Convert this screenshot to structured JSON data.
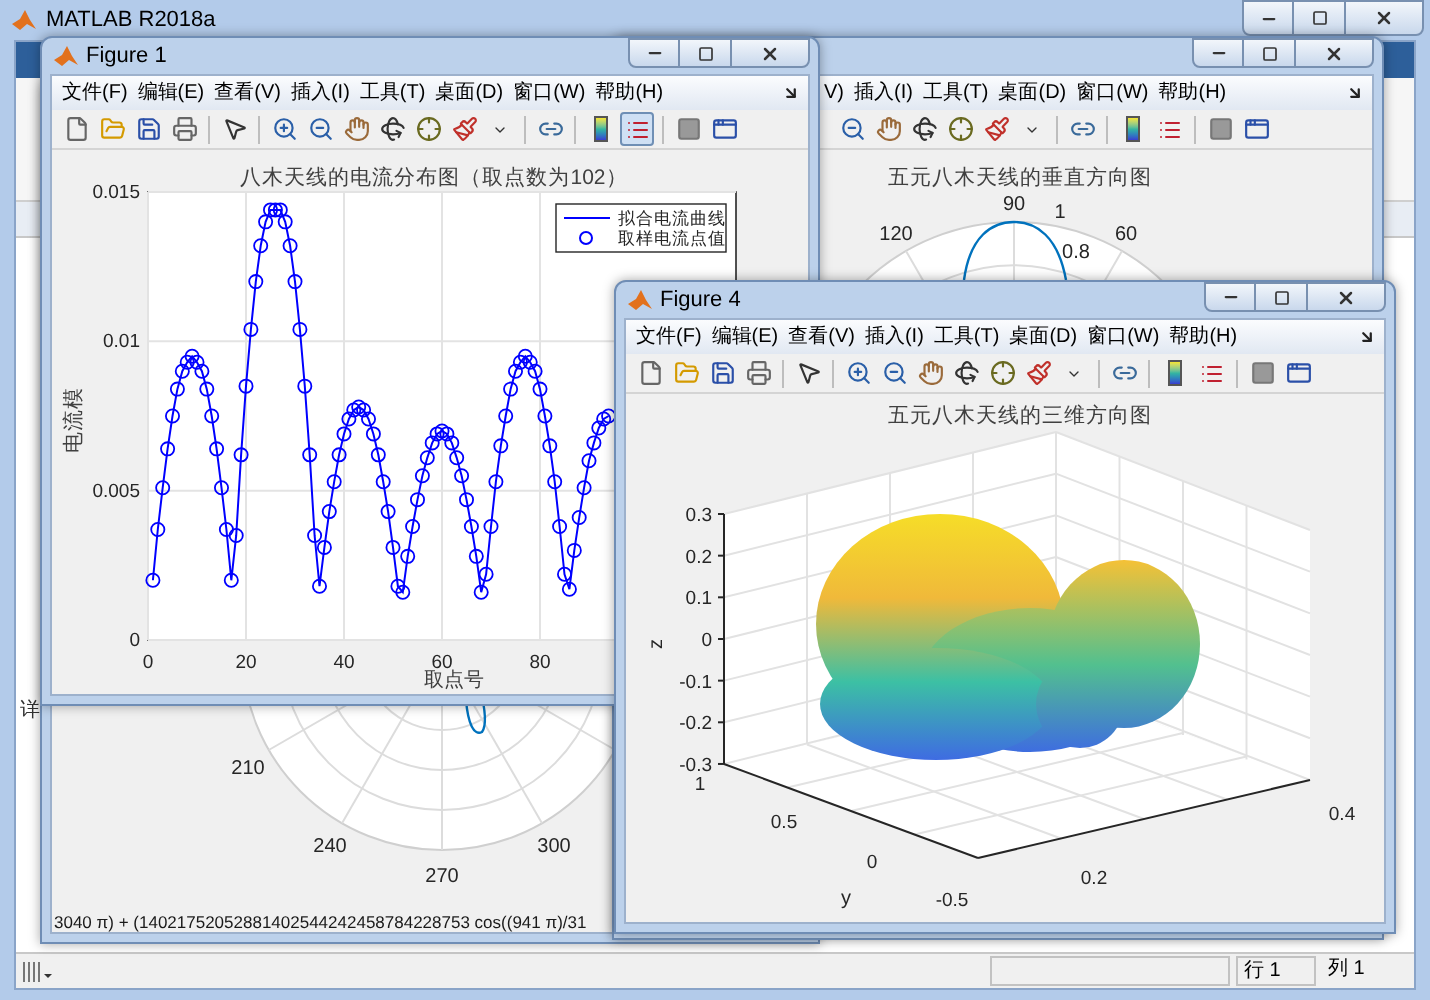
{
  "main_window": {
    "title": "MATLAB R2018a",
    "side_label": "详",
    "status_bar": {
      "row": "行 1",
      "column": "列 1"
    }
  },
  "figure_3": {
    "plot": {
      "angle_labels": [
        "210",
        "240",
        "270",
        "300"
      ],
      "caption": "3040 π) + (14021752052881402544242458784228753 cos((941 π)/31"
    }
  },
  "figure_2": {
    "menu": [
      "V)",
      "插入(I)",
      "工具(T)",
      "桌面(D)",
      "窗口(W)",
      "帮助(H)"
    ],
    "plot": {
      "title": "五元八木天线的垂直方向图",
      "angle_labels": [
        "90",
        "120",
        "60"
      ],
      "radius_labels": [
        "1",
        "0.8"
      ]
    }
  },
  "figure_1": {
    "title": "Figure 1",
    "marker_legend": "取样电流点值",
    "menu": [
      "文件(F)",
      "编辑(E)",
      "查看(V)",
      "插入(I)",
      "工具(T)",
      "桌面(D)",
      "窗口(W)",
      "帮助(H)"
    ],
    "toolbar": {
      "legend_on": true
    },
    "chart_data": {
      "type": "line",
      "grid": true,
      "title": "八木天线的电流分布图（取点数为102）",
      "xlabel": "取点号",
      "ylabel": "电流模",
      "xlim": [
        0,
        120
      ],
      "ylim": [
        0,
        0.015
      ],
      "xticks": [
        0,
        20,
        40,
        60,
        80
      ],
      "yticks": [
        0,
        0.005,
        0.01,
        0.015
      ],
      "x": [
        1,
        2,
        3,
        4,
        5,
        6,
        7,
        8,
        9,
        10,
        11,
        12,
        13,
        14,
        15,
        16,
        17,
        18,
        19,
        20,
        21,
        22,
        23,
        24,
        25,
        26,
        27,
        28,
        29,
        30,
        31,
        32,
        33,
        34,
        35,
        36,
        37,
        38,
        39,
        40,
        41,
        42,
        43,
        44,
        45,
        46,
        47,
        48,
        49,
        50,
        51,
        52,
        53,
        54,
        55,
        56,
        57,
        58,
        59,
        60,
        61,
        62,
        63,
        64,
        65,
        66,
        67,
        68,
        69,
        70,
        71,
        72,
        73,
        74,
        75,
        76,
        77,
        78,
        79,
        80,
        81,
        82,
        83,
        84,
        85,
        86,
        87,
        88,
        89,
        90,
        91,
        92,
        93,
        94
      ],
      "series": [
        {
          "name": "拟合电流曲线",
          "color": "#0000ff",
          "marker": "o",
          "values": [
            0.002,
            0.0037,
            0.0051,
            0.0064,
            0.0075,
            0.0084,
            0.009,
            0.0093,
            0.0095,
            0.0093,
            0.009,
            0.0084,
            0.0075,
            0.0064,
            0.0051,
            0.0037,
            0.002,
            0.0035,
            0.0062,
            0.0085,
            0.0104,
            0.012,
            0.0132,
            0.014,
            0.0144,
            0.0144,
            0.0144,
            0.014,
            0.0132,
            0.012,
            0.0104,
            0.0085,
            0.0062,
            0.0035,
            0.0018,
            0.0031,
            0.0043,
            0.0053,
            0.0062,
            0.0069,
            0.0074,
            0.0077,
            0.0078,
            0.0077,
            0.0074,
            0.0069,
            0.0062,
            0.0053,
            0.0043,
            0.0031,
            0.0018,
            0.0016,
            0.0028,
            0.0038,
            0.0047,
            0.0055,
            0.0061,
            0.0066,
            0.0069,
            0.007,
            0.0069,
            0.0066,
            0.0061,
            0.0055,
            0.0047,
            0.0038,
            0.0028,
            0.0016,
            0.0022,
            0.0038,
            0.0053,
            0.0065,
            0.0075,
            0.0084,
            0.009,
            0.0093,
            0.0095,
            0.0093,
            0.009,
            0.0084,
            0.0075,
            0.0065,
            0.0053,
            0.0038,
            0.0022,
            0.0017,
            0.003,
            0.0041,
            0.0051,
            0.006,
            0.0066,
            0.0071,
            0.0074,
            0.0075
          ]
        }
      ]
    }
  },
  "figure_4": {
    "title": "Figure 4",
    "menu": [
      "文件(F)",
      "编辑(E)",
      "查看(V)",
      "插入(I)",
      "工具(T)",
      "桌面(D)",
      "窗口(W)",
      "帮助(H)"
    ],
    "toolbar": {
      "legend_on": false
    },
    "plot": {
      "title": "五元八木天线的三维方向图",
      "zlabel": "z",
      "ylabel": "y",
      "zticks": [
        "0.3",
        "0.2",
        "0.1",
        "0",
        "-0.1",
        "-0.2",
        "-0.3"
      ],
      "yticks": [
        "1",
        "0.5",
        "0",
        "-0.5"
      ],
      "xticks": [
        "0.4",
        "0.2"
      ]
    }
  }
}
